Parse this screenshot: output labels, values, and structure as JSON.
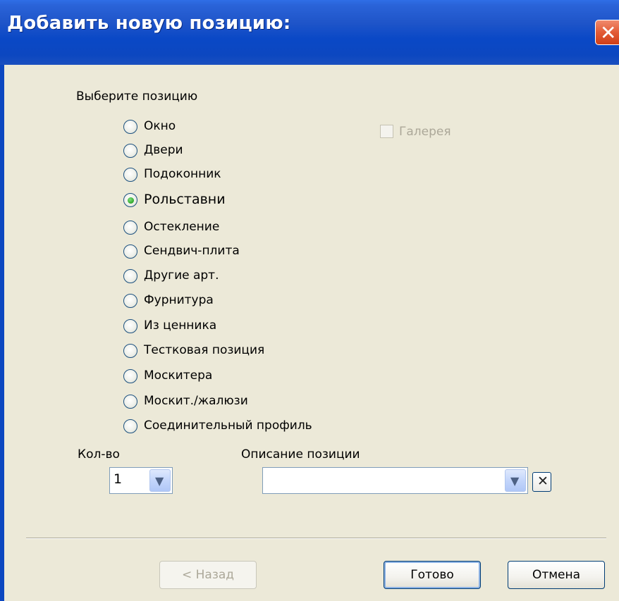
{
  "title": "Добавить новую позицию:",
  "section_label": "Выберите позицию",
  "radios": [
    {
      "label": "Окно",
      "checked": false
    },
    {
      "label": "Двери",
      "checked": false
    },
    {
      "label": "Подоконник",
      "checked": false
    },
    {
      "label": "Рольставни",
      "checked": true
    },
    {
      "label": "Остекление",
      "checked": false
    },
    {
      "label": "Сендвич-плита",
      "checked": false
    },
    {
      "label": "Другие арт.",
      "checked": false
    },
    {
      "label": "Фурнитура",
      "checked": false
    },
    {
      "label": "Из ценника",
      "checked": false
    },
    {
      "label": "Тестковая позиция",
      "checked": false
    },
    {
      "label": "Москитера",
      "checked": false
    },
    {
      "label": "Москит./жалюзи",
      "checked": false
    },
    {
      "label": "Соединительный профиль",
      "checked": false
    }
  ],
  "gallery_checkbox": {
    "label": "Галерея",
    "checked": false,
    "enabled": false
  },
  "quantity": {
    "label": "Кол-во",
    "value": "1"
  },
  "description": {
    "label": "Описание позиции",
    "value": ""
  },
  "buttons": {
    "back": "< Назад",
    "done": "Готово",
    "cancel": "Отмена"
  },
  "colors": {
    "titlebar": "#0a48c6",
    "window_bg": "#ECE9D8",
    "radio_selected": "#2fa52b"
  }
}
